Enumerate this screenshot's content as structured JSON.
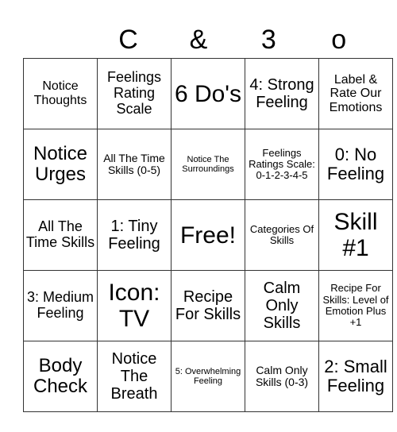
{
  "header": [
    "",
    "C",
    "&",
    "3",
    "o"
  ],
  "cells": [
    [
      "Notice Thoughts",
      "Feelings Rating Scale",
      "6 Do's",
      "4: Strong Feeling",
      "Label & Rate Our Emotions"
    ],
    [
      "Notice Urges",
      "All The Time Skills (0-5)",
      "Notice The Surroundings",
      "Feelings Ratings Scale: 0-1-2-3-4-5",
      "0: No Feeling"
    ],
    [
      "All The Time Skills",
      "1: Tiny Feeling",
      "Free!",
      "Categories Of Skills",
      "Skill #1"
    ],
    [
      "3: Medium Feeling",
      "Icon: TV",
      "Recipe For Skills",
      "Calm Only Skills",
      "Recipe For Skills: Level of Emotion Plus +1"
    ],
    [
      "Body Check",
      "Notice The Breath",
      "5: Overwhelming Feeling",
      "Calm Only Skills (0-3)",
      "2: Small Feeling"
    ]
  ]
}
